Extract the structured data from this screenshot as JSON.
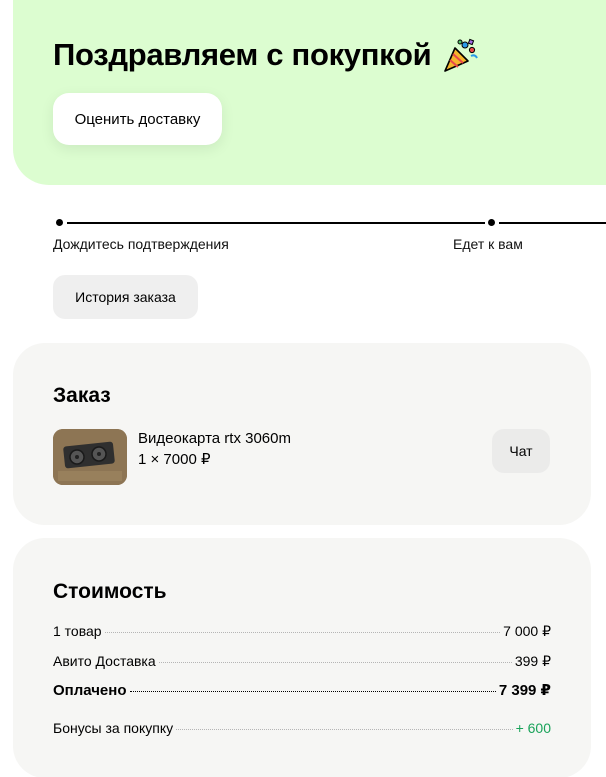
{
  "hero": {
    "title": "Поздравляем с покупкой",
    "rate_button": "Оценить доставку"
  },
  "progress": {
    "steps": [
      {
        "label": "Дождитесь подтверждения"
      },
      {
        "label": "Едет к вам"
      }
    ]
  },
  "history_button": "История заказа",
  "order": {
    "title": "Заказ",
    "item": {
      "name": "Видеокарта rtx 3060m",
      "qty_price": "1 × 7000 ₽"
    },
    "chat_button": "Чат"
  },
  "cost": {
    "title": "Стоимость",
    "rows": [
      {
        "label": "1 товар",
        "value": "7 000 ₽"
      },
      {
        "label": "Авито Доставка",
        "value": "399 ₽"
      },
      {
        "label": "Оплачено",
        "value": "7 399 ₽"
      },
      {
        "label": "Бонусы за покупку",
        "value": "+ 600"
      }
    ]
  },
  "colors": {
    "hero_bg": "#dcfdd0",
    "card_bg": "#f6f6f4",
    "bonus_green": "#1aa35a"
  },
  "icons": {
    "hero": "party-popper-icon",
    "item": "graphics-card-photo"
  }
}
